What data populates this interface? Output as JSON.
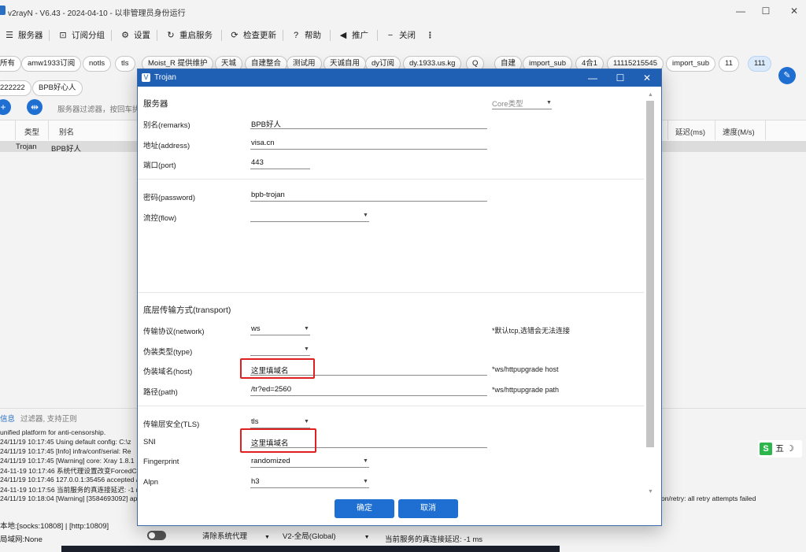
{
  "app": {
    "title": "v2rayN - V6.43 - 2024-04-10 - 以非管理员身份运行",
    "window_controls": {
      "minimize": "—",
      "maximize": "☐",
      "close": "✕"
    }
  },
  "toolbar": {
    "servers": "服务器",
    "subscription_group": "订阅分组",
    "settings": "设置",
    "restart_service": "重启服务",
    "check_update": "检查更新",
    "help": "帮助",
    "promotion": "推广",
    "close": "关闭",
    "more": "⋮"
  },
  "chips": [
    "所有",
    "amw1933订阅",
    "notls",
    "tls",
    "Moist_R 提供维护",
    "天城",
    "自建整合",
    "测试用",
    "天诚自用",
    "dy订阅",
    "dy.1933.us.kg",
    "Q",
    "自建",
    "import_sub",
    "4合1",
    "11115215545",
    "import_sub",
    "11",
    "111"
  ],
  "chips_row2": [
    "222222",
    "BPB好心人"
  ],
  "filter": {
    "placeholder": "服务器过滤器，按回车执"
  },
  "grid": {
    "headers": {
      "type": "类型",
      "name": "别名",
      "latency": "延迟(ms)",
      "speed": "速度(M/s)"
    },
    "row": {
      "type": "Trojan",
      "name": "BPB好人"
    }
  },
  "log": {
    "tab": "信息",
    "filter_placeholder": "过滤器, 支持正则",
    "lines": [
      "unified platform for anti-censorship.",
      "24/11/19 10:17:45 Using default config:  C:\\z",
      "24/11/19 10:17:45 [Info] infra/conf/serial: Re",
      "24/11/19 10:17:45 [Warning] core: Xray 1.8.1",
      "24-11-19 10:17:46 系统代理设置改变ForcedCle",
      "24/11/19 10:17:46 127.0.0.1:35456 accepted /",
      "24-11-19 10:17:56 当前服务的真连接延迟: -1 m",
      "24/11/19 10:18:04 [Warning] [3584693092] ap"
    ],
    "right_error": "on/retry: all retry attempts failed"
  },
  "status": {
    "local": "本地:[socks:10808] | [http:10809]",
    "lan": "局域网:None",
    "system_proxy": "清除系统代理",
    "routing": "V2-全局(Global)",
    "latency": "当前服务的真连接延迟: -1 ms"
  },
  "ime": {
    "label": "五"
  },
  "dialog": {
    "title": "Trojan",
    "section_server": "服务器",
    "core_type": "Core类型",
    "remarks_label": "别名(remarks)",
    "remarks": "BPB好人",
    "address_label": "地址(address)",
    "address": "visa.cn",
    "port_label": "端口(port)",
    "port": "443",
    "password_label": "密码(password)",
    "password": "bpb-trojan",
    "flow_label": "流控(flow)",
    "flow": "",
    "section_transport": "底层传输方式(transport)",
    "network_label": "传输协议(network)",
    "network": "ws",
    "network_note": "*默认tcp,选错会无法连接",
    "type_label": "伪装类型(type)",
    "type": "",
    "host_label": "伪装域名(host)",
    "host": "这里填域名",
    "host_note": "*ws/httpupgrade host",
    "path_label": "路径(path)",
    "path": "/tr?ed=2560",
    "path_note": "*ws/httpupgrade path",
    "tls_label": "传输层安全(TLS)",
    "tls": "tls",
    "sni_label": "SNI",
    "sni": "这里填域名",
    "fingerprint_label": "Fingerprint",
    "fingerprint": "randomized",
    "alpn_label": "Alpn",
    "alpn": "h3",
    "ok": "确定",
    "cancel": "取消"
  }
}
